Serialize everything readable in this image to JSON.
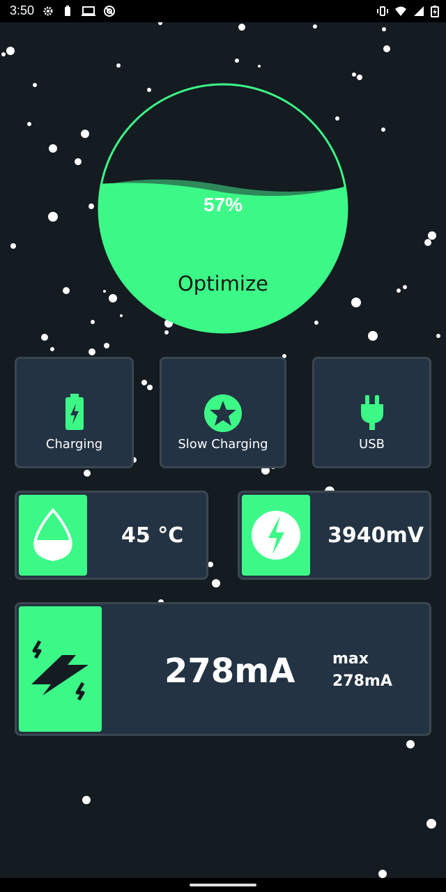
{
  "status_bar": {
    "time": "3:50",
    "left_icons": [
      "settings-icon",
      "battery-small-icon",
      "laptop-icon",
      "at-sign-icon"
    ],
    "right_icons": [
      "vibrate-icon",
      "wifi-icon",
      "signal-icon",
      "battery-charging-icon"
    ]
  },
  "gauge": {
    "level_percent": 57,
    "percent_label": "57%",
    "action_label": "Optimize",
    "fill_color": "#3cf987",
    "ring_color": "#3cf987"
  },
  "modes": [
    {
      "label": "Charging",
      "icon": "battery-charging-icon"
    },
    {
      "label": "Slow Charging",
      "icon": "star-icon"
    },
    {
      "label": "USB",
      "icon": "plug-icon"
    }
  ],
  "stats": {
    "temperature": {
      "value": "45 °C",
      "icon": "drop-icon"
    },
    "voltage": {
      "value": "3940mV",
      "icon": "bolt-circle-icon"
    },
    "current": {
      "value": "278mA",
      "max_label": "max",
      "max_value": "278mA",
      "icon": "double-bolt-icon"
    }
  },
  "colors": {
    "background": "#141b21",
    "card": "#233343",
    "accent": "#3cf987"
  }
}
